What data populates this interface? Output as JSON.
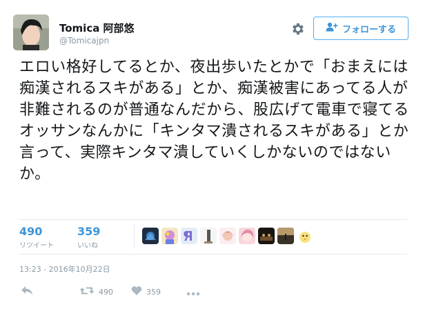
{
  "author": {
    "name": "Tomica 阿部悠",
    "handle": "@Tomicajpn"
  },
  "header": {
    "settings_icon": "gear-icon",
    "follow_label": "フォローする",
    "follow_icon": "add-user-icon"
  },
  "tweet": {
    "text": "エロい格好してるとか、夜出歩いたとかで「おまえには痴漢されるスキがある」とか、痴漢被害にあってる人が非難されるのが普通なんだから、股広げて電車で寝てるオッサンなんかに「キンタマ潰されるスキがある」とか言って、実際キンタマ潰していくしかないのではないか。"
  },
  "stats": {
    "retweets_count": "490",
    "retweets_label": "リツイート",
    "likes_count": "359",
    "likes_label": "いいね"
  },
  "timestamp": "13:23 - 2016年10月22日",
  "actions": {
    "reply_icon": "reply-icon",
    "retweet_icon": "retweet-icon",
    "retweet_count": "490",
    "like_icon": "heart-icon",
    "like_count": "359",
    "more_icon": "more-icon"
  },
  "colors": {
    "accent": "#3b94d9",
    "muted": "#8899a6",
    "divider": "#e1e8ed",
    "text": "#14171a"
  }
}
